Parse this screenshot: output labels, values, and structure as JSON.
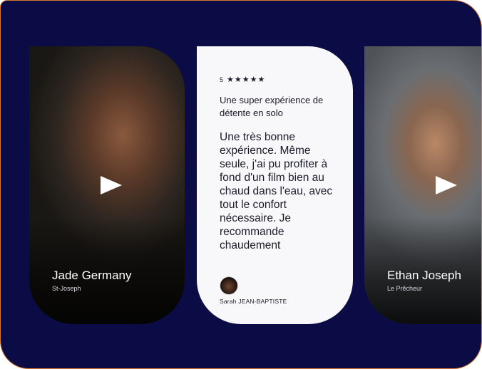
{
  "testimonials": {
    "left": {
      "name": "Jade Germany",
      "location": "St-Joseph"
    },
    "review": {
      "rating": "5",
      "stars": "★★★★★",
      "title": "Une super expérience de détente en solo",
      "body": "Une très bonne expérience. Même seule, j'ai pu profiter à fond d'un film bien au chaud dans l'eau, avec tout le confort nécessaire. Je recommande chaudement",
      "author": "Sarah JEAN-BAPTISTE"
    },
    "right": {
      "name": "Ethan Joseph",
      "location": "Le Prêcheur"
    }
  },
  "colors": {
    "background": "#0b0b45",
    "border": "#d4792e",
    "card": "#f8f8fa"
  }
}
